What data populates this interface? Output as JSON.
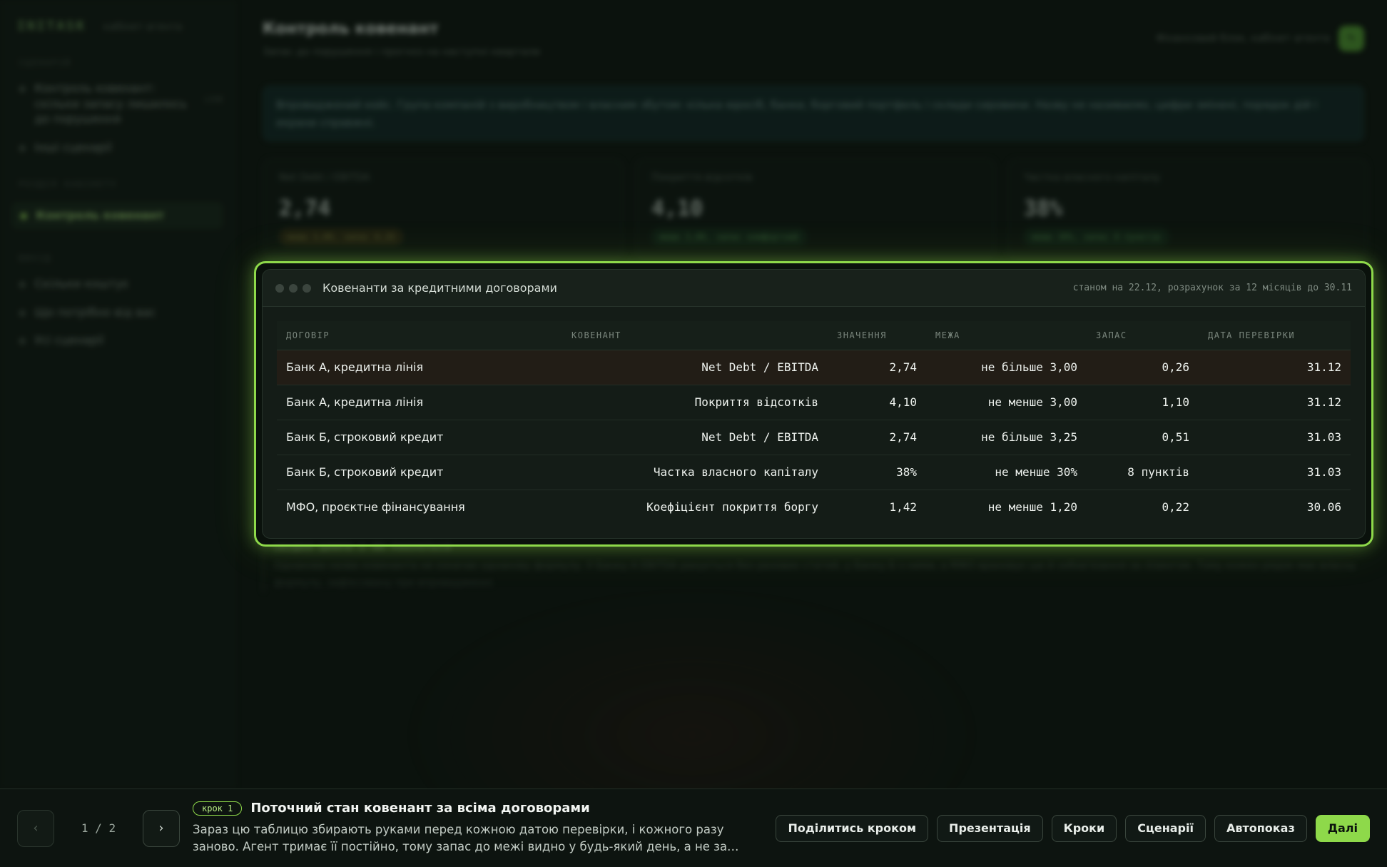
{
  "app": {
    "brand": "INITASK",
    "brand_sub": "кабінет агента",
    "title": "Контроль ковенант",
    "subtitle": "Запас до порушення і прогноз на наступні квартали",
    "header_right": "Фінансовий блок, кабінет агента"
  },
  "sidebar": {
    "group1": "Сценарій",
    "items1": [
      {
        "label": "Контроль ковенант: скільки запасу лишилось до порушення",
        "badge": "LIVE"
      },
      {
        "label": "Інші сценарії"
      }
    ],
    "group2": "Розділ кабінету",
    "items2": [
      {
        "label": "Контроль ковенант"
      }
    ],
    "group3": "Вихід",
    "items3": [
      {
        "label": "Скільки коштує"
      },
      {
        "label": "Що потрібно від вас"
      },
      {
        "label": "Усі сценарії"
      }
    ]
  },
  "note": "Впроваджений кейс. Група компаній з виробництвом і власним збутом: кілька юросіб, банки, борговий портфель і склади сировини. Назву не називаємо, цифри змінені, порядок дій і екрани справжні.",
  "kpis": [
    {
      "label": "Net Debt / EBITDA",
      "value": "2,74",
      "chip": "межа 3,00, запас 0,26",
      "status": "warn"
    },
    {
      "label": "Покриття відсотків",
      "value": "4,10",
      "chip": "межа 3,00, запас комфортний",
      "status": "ok"
    },
    {
      "label": "Частка власного капіталу",
      "value": "38%",
      "chip": "межа 30%, запас 8 пунктів",
      "status": "ok"
    }
  ],
  "table": {
    "title": "Ковенанти за кредитними договорами",
    "meta": "станом на 22.12, розрахунок за 12 місяців до 30.11",
    "columns": [
      "ДОГОВІР",
      "КОВЕНАНТ",
      "ЗНАЧЕННЯ",
      "МЕЖА",
      "ЗАПАС",
      "ДАТА ПЕРЕВІРКИ"
    ],
    "rows": [
      {
        "contract": "Банк А, кредитна лінія",
        "covenant": "Net Debt / EBITDA",
        "value": "2,74",
        "limit": "не більше 3,00",
        "margin": "0,26",
        "date": "31.12"
      },
      {
        "contract": "Банк А, кредитна лінія",
        "covenant": "Покриття відсотків",
        "value": "4,10",
        "limit": "не менше 3,00",
        "margin": "1,10",
        "date": "31.12"
      },
      {
        "contract": "Банк Б, строковий кредит",
        "covenant": "Net Debt / EBITDA",
        "value": "2,74",
        "limit": "не більше 3,25",
        "margin": "0,51",
        "date": "31.03"
      },
      {
        "contract": "Банк Б, строковий кредит",
        "covenant": "Частка власного капіталу",
        "value": "38%",
        "limit": "не менше 30%",
        "margin": "8 пунктів",
        "date": "31.03"
      },
      {
        "contract": "МФО, проєктне фінансування",
        "covenant": "Коефіцієнт покриття боргу",
        "value": "1,42",
        "limit": "не менше 1,20",
        "margin": "0,22",
        "date": "30.06"
      }
    ]
  },
  "footnote": {
    "title": "ЗВІДКИ ЦИФРИ І ЯК РАХУЄТЬСЯ",
    "text": "Однакова назва ковенанта не означає однакову формулу. У Банку А EBITDA рахується без разових статей, у Банку Б з ними, а МФО враховує ще й зобов'язання за лізингом. Тому кожен рядок має власну формулу, зафіксовану при впровадженні."
  },
  "tour": {
    "prev_icon": "chevron-left-icon",
    "next_icon": "chevron-right-icon",
    "pager": "1 / 2",
    "step_chip": "крок 1",
    "step_title": "Поточний стан ковенант за всіма договорами",
    "step_text": "Зараз цю таблицю збирають руками перед кожною датою перевірки, і кожного разу заново. Агент тримає її постійно, тому запас до межі видно у будь-який день, а не за…",
    "actions": {
      "share": "Поділитись кроком",
      "present": "Презентація",
      "steps": "Кроки",
      "scenarios": "Сценарії",
      "autoplay": "Автопоказ",
      "next": "Далі"
    }
  },
  "colors": {
    "accent": "#8ed94a",
    "background": "#0b120d"
  }
}
